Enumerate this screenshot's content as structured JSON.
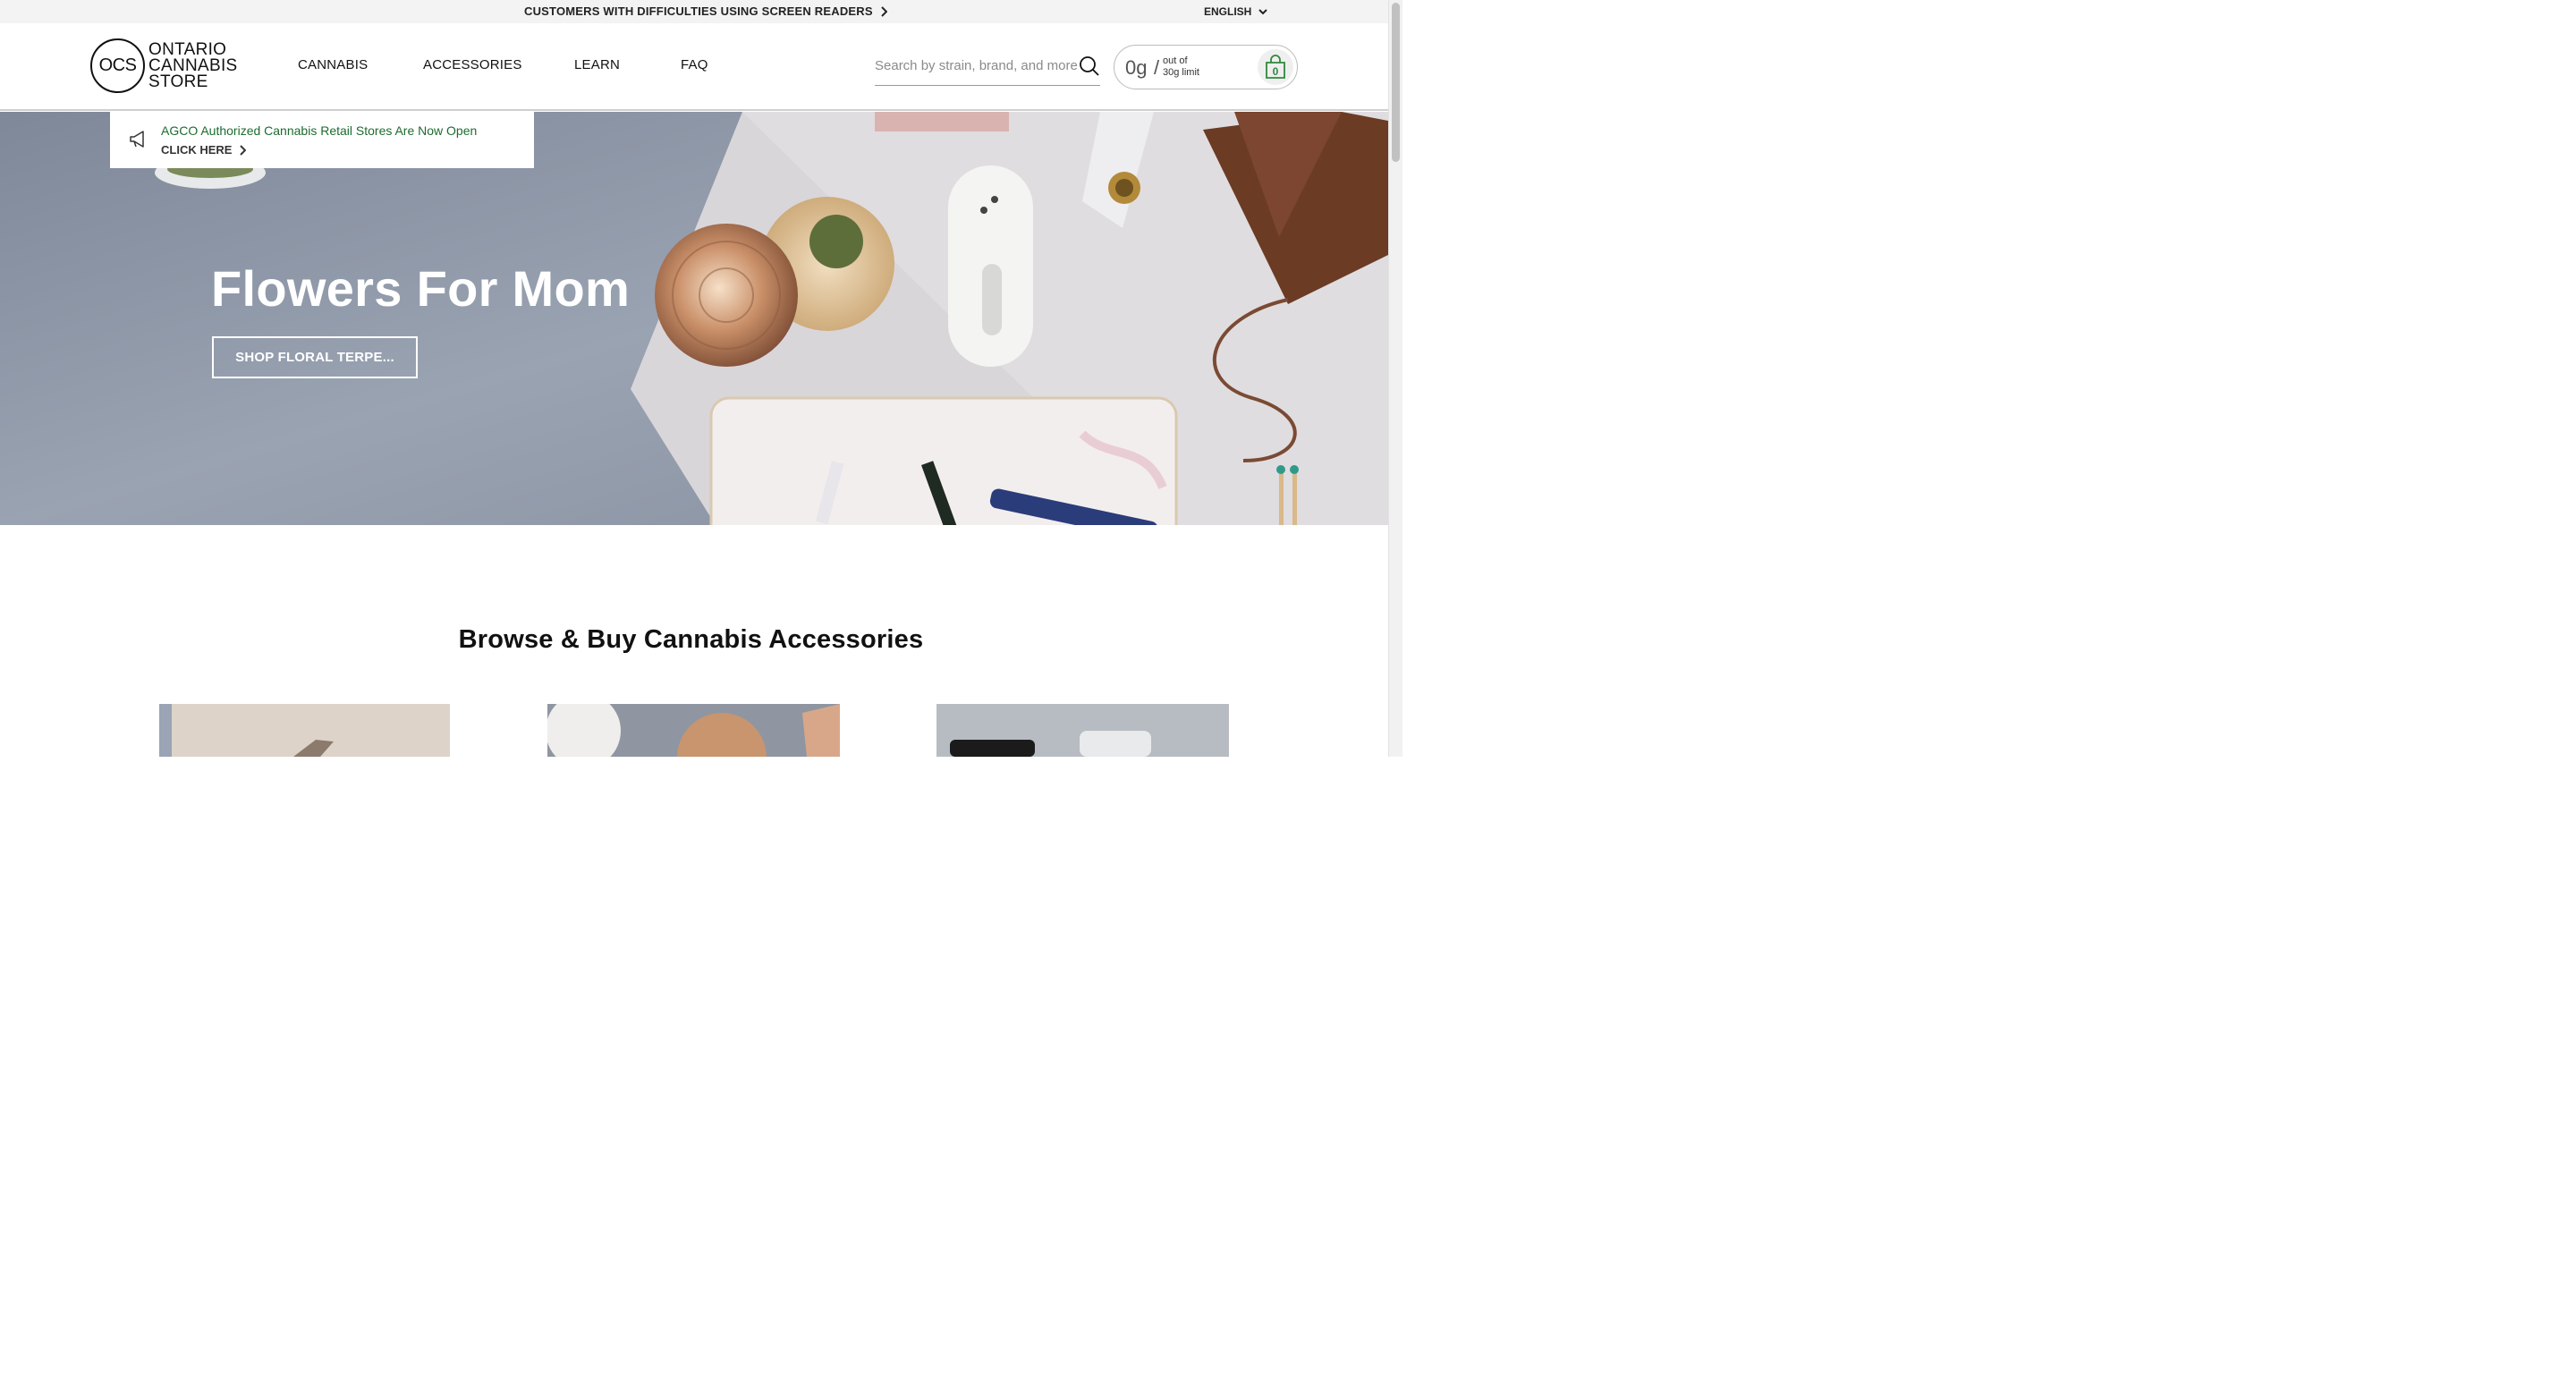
{
  "topbar": {
    "accessibility_link": "CUSTOMERS WITH DIFFICULTIES USING SCREEN READERS",
    "language": "ENGLISH"
  },
  "header": {
    "logo_mark": "OCS",
    "logo_line1": "ONTARIO",
    "logo_line2": "CANNABIS",
    "logo_line3": "STORE",
    "nav": [
      "CANNABIS",
      "ACCESSORIES",
      "LEARN",
      "FAQ"
    ],
    "search_placeholder": "Search by strain, brand, and more",
    "limit_amount": "0g",
    "limit_slash": "/",
    "limit_text_line1": "out of",
    "limit_text_line2": "30g limit",
    "cart_count": "0"
  },
  "announcement": {
    "title": "AGCO Authorized Cannabis Retail Stores Are Now Open",
    "cta": "CLICK HERE"
  },
  "hero": {
    "heading": "Flowers For Mom",
    "button": "SHOP FLORAL TERPE..."
  },
  "section": {
    "title": "Browse & Buy Cannabis Accessories"
  },
  "colors": {
    "announcement_green": "#1d6b2f",
    "hero_bg": "#8e98a8"
  }
}
